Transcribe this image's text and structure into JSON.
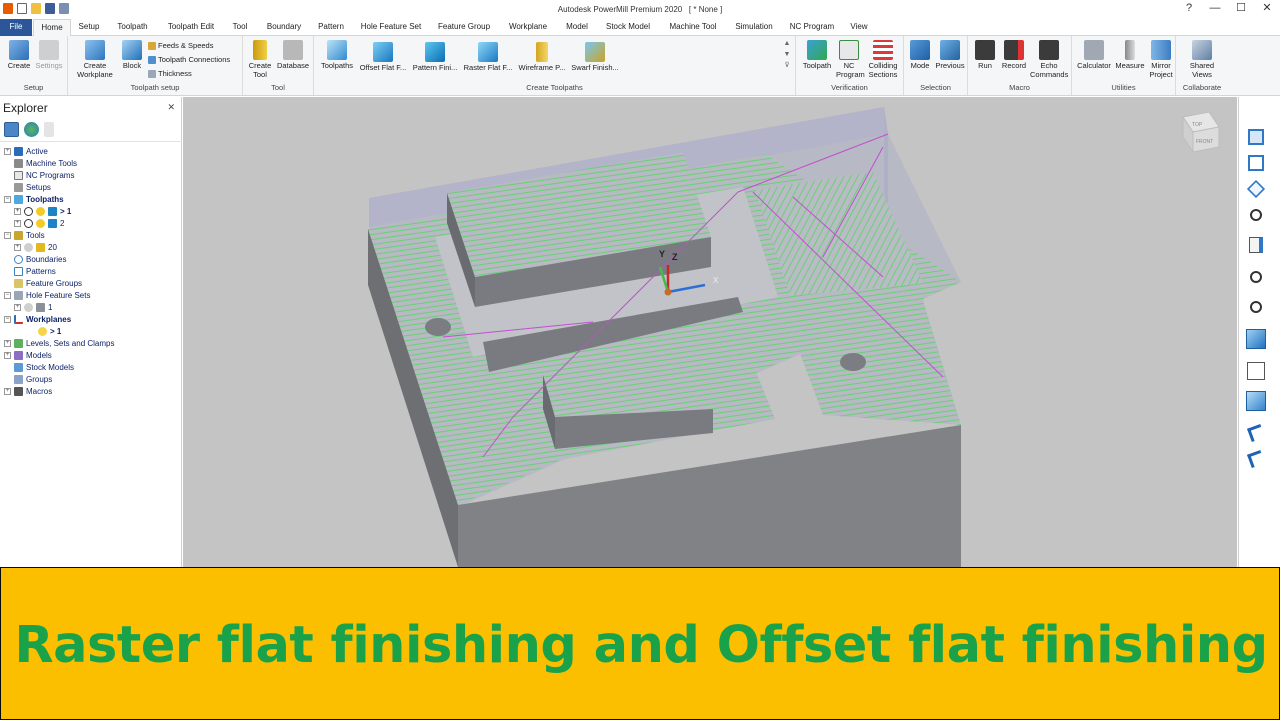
{
  "window": {
    "title": "Autodesk PowerMill Premium 2020",
    "doc_tag": "[ * None ]",
    "controls": [
      "?",
      "—",
      "☐",
      "✕"
    ]
  },
  "tabs": [
    "File",
    "Home",
    "Setup",
    "Toolpath",
    "Toolpath Edit",
    "Tool",
    "Boundary",
    "Pattern",
    "Hole Feature Set",
    "Feature Group",
    "Workplane",
    "Model",
    "Stock Model",
    "Machine Tool",
    "Simulation",
    "NC Program",
    "View"
  ],
  "ribbon": {
    "setup": {
      "label": "Setup",
      "create": "Create",
      "settings": "Settings"
    },
    "toolpath_setup": {
      "label": "Toolpath setup",
      "create_workplane": "Create Workplane",
      "block": "Block",
      "feeds": "Feeds & Speeds",
      "connections": "Toolpath Connections",
      "thickness": "Thickness"
    },
    "tool": {
      "label": "Tool",
      "create_tool": "Create Tool",
      "database": "Database"
    },
    "create_toolpaths": {
      "label": "Create Toolpaths",
      "toolpaths": "Toolpaths",
      "strategies": [
        "Offset Flat F...",
        "Pattern Fini...",
        "Raster Flat F...",
        "Wireframe P...",
        "Swarf Finish..."
      ]
    },
    "verification": {
      "label": "Verification",
      "toolpath": "Toolpath",
      "nc_program": "NC Program",
      "colliding": "Colliding Sections"
    },
    "selection": {
      "label": "Selection",
      "mode": "Mode",
      "previous": "Previous"
    },
    "macro": {
      "label": "Macro",
      "run": "Run",
      "record": "Record",
      "echo": "Echo Commands"
    },
    "utilities": {
      "label": "Utilities",
      "calculator": "Calculator",
      "measure": "Measure",
      "mirror": "Mirror Project"
    },
    "collaborate": {
      "label": "Collaborate",
      "shared": "Shared Views"
    }
  },
  "explorer": {
    "title": "Explorer",
    "items": [
      "Active",
      "Machine Tools",
      "NC Programs",
      "Setups",
      "Toolpaths",
      "> 1",
      "2",
      "Tools",
      "20",
      "Boundaries",
      "Patterns",
      "Feature Groups",
      "Hole Feature Sets",
      "1",
      "Workplanes",
      "> 1",
      "Levels, Sets and Clamps",
      "Models",
      "Stock Models",
      "Groups",
      "Macros"
    ]
  },
  "viewport": {
    "axis_y": "Y",
    "axis_z": "Z",
    "axis_x": "X",
    "viewcube_top": "TOP",
    "viewcube_front": "FRONT"
  },
  "banner": {
    "text": "Raster flat finishing and Offset flat finishing"
  }
}
